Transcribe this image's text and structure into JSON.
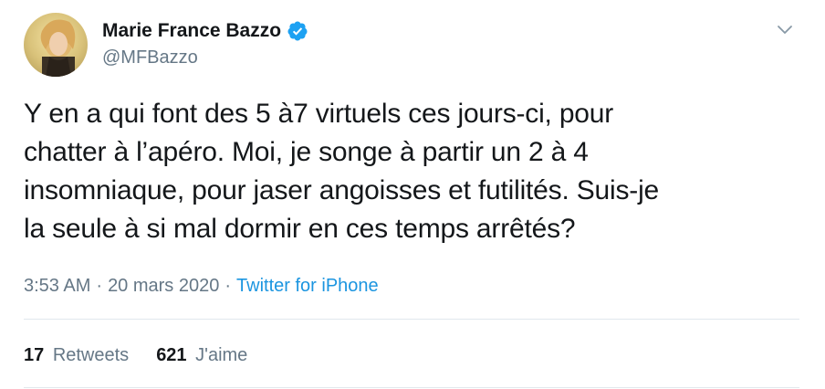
{
  "author": {
    "display_name": "Marie France Bazzo",
    "handle": "@MFBazzo",
    "verified_icon": "verified-badge-icon",
    "avatar_icon": "avatar-photo"
  },
  "tweet": {
    "text_lines": [
      "Y en a qui font des 5 à7 virtuels ces jours-ci, pour",
      "chatter à l’apéro. Moi, je songe à partir un 2 à 4",
      "insomniaque, pour jaser angoisses et futilités. Suis-je",
      "la seule à si mal dormir en ces temps arrêtés?"
    ]
  },
  "meta": {
    "time": "3:53 AM",
    "separator": "·",
    "date": "20 mars 2020",
    "source": "Twitter for iPhone"
  },
  "stats": {
    "retweets_count": "17",
    "retweets_label": "Retweets",
    "likes_count": "621",
    "likes_label": "J'aime"
  },
  "colors": {
    "text": "#14171a",
    "secondary": "#657786",
    "link": "#1b95e0",
    "verified": "#1da1f2",
    "divider": "#e1e8ed"
  },
  "menu": {
    "icon": "chevron-down-icon"
  }
}
